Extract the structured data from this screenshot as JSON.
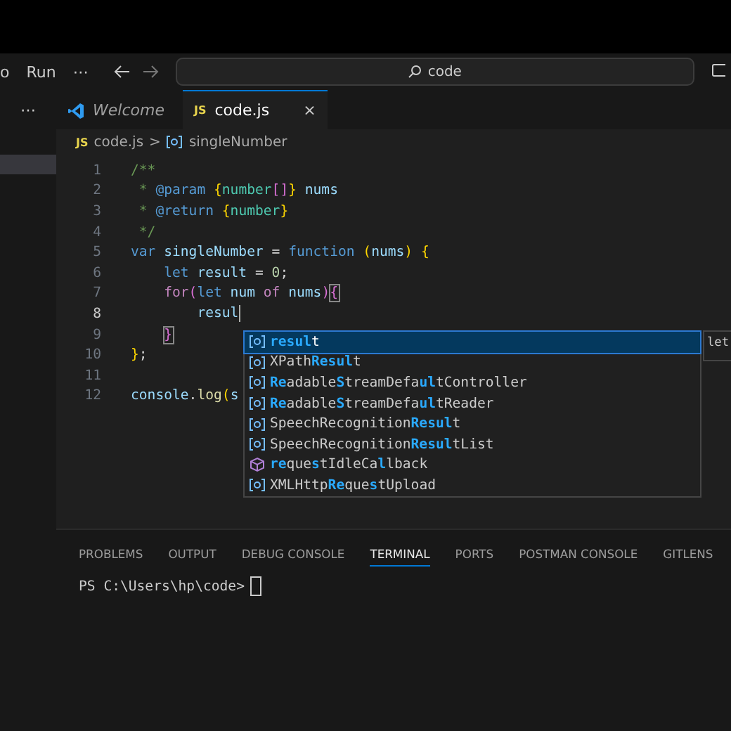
{
  "menu_bar": {
    "items": [
      "o",
      "Run",
      "⋯"
    ],
    "search": {
      "value": "code"
    }
  },
  "sidebar": {
    "more": "⋯",
    "items": [
      {
        "selected": true
      }
    ]
  },
  "tabs": [
    {
      "label": "Welcome",
      "kind": "welcome",
      "selected": false
    },
    {
      "label": "code.js",
      "kind": "file",
      "icon_label": "JS",
      "selected": true,
      "close": "×"
    }
  ],
  "breadcrumb": {
    "file_icon": "JS",
    "file": "code.js",
    "separator": ">",
    "symbol": "singleNumber"
  },
  "editor": {
    "lines": [
      {
        "number": "1",
        "current": false,
        "tokens": [
          {
            "kind": "comment",
            "text": "/**"
          }
        ]
      },
      {
        "number": "2",
        "current": false,
        "tokens": [
          {
            "kind": "comment",
            "text": " * "
          },
          {
            "kind": "keyword",
            "text": "@param "
          },
          {
            "kind": "brace",
            "text": "{"
          },
          {
            "kind": "type",
            "text": "number"
          },
          {
            "kind": "punct",
            "text": "[]"
          },
          {
            "kind": "brace",
            "text": "} "
          },
          {
            "kind": "variable",
            "text": "nums"
          }
        ]
      },
      {
        "number": "3",
        "current": false,
        "tokens": [
          {
            "kind": "comment",
            "text": " * "
          },
          {
            "kind": "keyword",
            "text": "@return "
          },
          {
            "kind": "brace",
            "text": "{"
          },
          {
            "kind": "type",
            "text": "number"
          },
          {
            "kind": "brace",
            "text": "}"
          }
        ]
      },
      {
        "number": "4",
        "current": false,
        "tokens": [
          {
            "kind": "comment",
            "text": " */"
          }
        ]
      },
      {
        "number": "5",
        "current": false,
        "tokens": [
          {
            "kind": "keyword",
            "text": "var "
          },
          {
            "kind": "variable",
            "text": "singleNumber "
          },
          {
            "kind": "plain",
            "text": "= "
          },
          {
            "kind": "keyword",
            "text": "function "
          },
          {
            "kind": "brace",
            "text": "("
          },
          {
            "kind": "variable",
            "text": "nums"
          },
          {
            "kind": "brace",
            "text": ") {"
          }
        ]
      },
      {
        "number": "6",
        "current": false,
        "tokens": [
          {
            "kind": "keyword",
            "text": "    let "
          },
          {
            "kind": "variable",
            "text": "result "
          },
          {
            "kind": "plain",
            "text": "= "
          },
          {
            "kind": "number",
            "text": "0"
          },
          {
            "kind": "plain",
            "text": ";"
          }
        ]
      },
      {
        "number": "7",
        "current": false,
        "tokens": [
          {
            "kind": "control",
            "text": "    for"
          },
          {
            "kind": "paren",
            "text": "("
          },
          {
            "kind": "keyword",
            "text": "let "
          },
          {
            "kind": "variable",
            "text": "num "
          },
          {
            "kind": "control",
            "text": "of "
          },
          {
            "kind": "variable",
            "text": "nums"
          },
          {
            "kind": "paren",
            "text": ")"
          },
          {
            "kind": "match",
            "text": "{"
          }
        ]
      },
      {
        "number": "8",
        "current": true,
        "tokens": [
          {
            "kind": "variable",
            "text": "        resul"
          }
        ]
      },
      {
        "number": "9",
        "current": false,
        "tokens": [
          {
            "kind": "match",
            "text": "    }"
          }
        ]
      },
      {
        "number": "10",
        "current": false,
        "tokens": [
          {
            "kind": "brace",
            "text": "}"
          },
          {
            "kind": "plain",
            "text": ";"
          }
        ]
      },
      {
        "number": "11",
        "current": false
      },
      {
        "number": "12",
        "current": false,
        "tokens": [
          {
            "kind": "variable",
            "text": "console"
          },
          {
            "kind": "plain",
            "text": "."
          },
          {
            "kind": "function",
            "text": "log"
          },
          {
            "kind": "brace",
            "text": "("
          },
          {
            "kind": "variable",
            "text": "s"
          }
        ]
      }
    ]
  },
  "suggestions": {
    "detail": "let",
    "items": [
      {
        "kind": "variable",
        "selected": true,
        "parts": [
          {
            "text": "resul",
            "match": true
          },
          {
            "text": "t",
            "match": false
          }
        ]
      },
      {
        "kind": "variable",
        "selected": false,
        "parts": [
          {
            "text": "XPath",
            "match": false
          },
          {
            "text": "Resul",
            "match": true
          },
          {
            "text": "t",
            "match": false
          }
        ]
      },
      {
        "kind": "variable",
        "selected": false,
        "parts": [
          {
            "text": "Re",
            "match": true
          },
          {
            "text": "adable",
            "match": false
          },
          {
            "text": "S",
            "match": true
          },
          {
            "text": "treamDefa",
            "match": false
          },
          {
            "text": "ul",
            "match": true
          },
          {
            "text": "tController",
            "match": false
          }
        ]
      },
      {
        "kind": "variable",
        "selected": false,
        "parts": [
          {
            "text": "Re",
            "match": true
          },
          {
            "text": "adable",
            "match": false
          },
          {
            "text": "S",
            "match": true
          },
          {
            "text": "treamDefa",
            "match": false
          },
          {
            "text": "ul",
            "match": true
          },
          {
            "text": "tReader",
            "match": false
          }
        ]
      },
      {
        "kind": "variable",
        "selected": false,
        "parts": [
          {
            "text": "SpeechRecognition",
            "match": false
          },
          {
            "text": "Resul",
            "match": true
          },
          {
            "text": "t",
            "match": false
          }
        ]
      },
      {
        "kind": "variable",
        "selected": false,
        "parts": [
          {
            "text": "SpeechRecognition",
            "match": false
          },
          {
            "text": "Resul",
            "match": true
          },
          {
            "text": "tList",
            "match": false
          }
        ]
      },
      {
        "kind": "method",
        "selected": false,
        "parts": [
          {
            "text": "re",
            "match": true
          },
          {
            "text": "que",
            "match": false
          },
          {
            "text": "s",
            "match": true
          },
          {
            "text": "tIdleCa",
            "match": false
          },
          {
            "text": "l",
            "match": true
          },
          {
            "text": "lback",
            "match": false
          }
        ]
      },
      {
        "kind": "variable",
        "selected": false,
        "parts": [
          {
            "text": "XMLHttp",
            "match": false
          },
          {
            "text": "Re",
            "match": true
          },
          {
            "text": "que",
            "match": false
          },
          {
            "text": "s",
            "match": true
          },
          {
            "text": "tUpload",
            "match": false
          }
        ]
      }
    ]
  },
  "panel": {
    "tabs": [
      {
        "label": "PROBLEMS",
        "selected": false
      },
      {
        "label": "OUTPUT",
        "selected": false
      },
      {
        "label": "DEBUG CONSOLE",
        "selected": false
      },
      {
        "label": "TERMINAL",
        "selected": true
      },
      {
        "label": "PORTS",
        "selected": false
      },
      {
        "label": "POSTMAN CONSOLE",
        "selected": false
      },
      {
        "label": "GITLENS",
        "selected": false
      }
    ],
    "prompt": "PS C:\\Users\\hp\\code>"
  }
}
